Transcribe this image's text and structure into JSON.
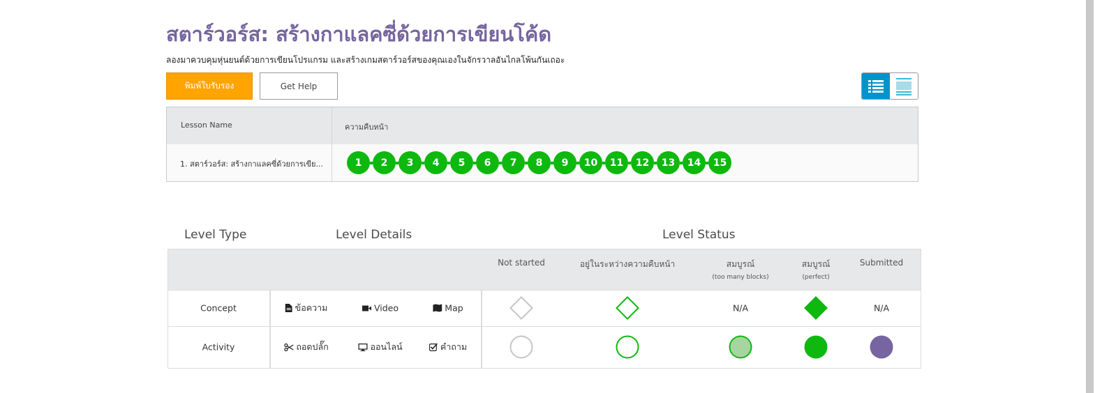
{
  "page": {
    "title": "สตาร์วอร์ส: สร้างกาแลคซี่ด้วยการเขียนโค้ด",
    "subtitle": "ลองมาควบคุมหุ่นยนต์ด้วยการเขียนโปรแกรม และสร้างเกมสตาร์วอร์สของคุณเองในจักรวาลอันไกลโพ้นกันเถอะ"
  },
  "buttons": {
    "certificate": "พิมพ์ใบรับรอง",
    "help": "Get Help"
  },
  "view_toggle": {
    "selected": "list"
  },
  "progress_table": {
    "headers": {
      "lesson_name": "Lesson Name",
      "progress": "ความคืบหน้า"
    },
    "rows": [
      {
        "lesson": "1. สตาร์วอร์ส: สร้างกาแลคซี่ด้วยการเขีย...",
        "levels": [
          "1",
          "2",
          "3",
          "4",
          "5",
          "6",
          "7",
          "8",
          "9",
          "10",
          "11",
          "12",
          "13",
          "14",
          "15"
        ]
      }
    ]
  },
  "key": {
    "headings": {
      "level_type": "Level Type",
      "level_details": "Level Details",
      "level_status": "Level Status"
    },
    "status_columns": [
      {
        "label": "Not started",
        "sub": ""
      },
      {
        "label": "อยู่ในระหว่างความคืบหน้า",
        "sub": ""
      },
      {
        "label": "สมบูรณ์",
        "sub": "(too many blocks)"
      },
      {
        "label": "สมบูรณ์",
        "sub": "(perfect)"
      },
      {
        "label": "Submitted",
        "sub": ""
      }
    ],
    "rows": [
      {
        "type": "Concept",
        "details": [
          {
            "icon": "document-icon",
            "label": "ข้อความ"
          },
          {
            "icon": "video-camera-icon",
            "label": "Video"
          },
          {
            "icon": "map-icon",
            "label": "Map"
          }
        ],
        "statuses": [
          "diamond-empty-grey",
          "diamond-empty-green",
          "N/A",
          "diamond-filled-green",
          "N/A"
        ]
      },
      {
        "type": "Activity",
        "details": [
          {
            "icon": "scissors-icon",
            "label": "ถอดปลั๊ก"
          },
          {
            "icon": "desktop-icon",
            "label": "ออนไลน์"
          },
          {
            "icon": "checkbox-icon",
            "label": "คำถาม"
          }
        ],
        "statuses": [
          "circle-empty-grey",
          "circle-empty-green",
          "circle-light-green",
          "circle-filled-green",
          "circle-purple"
        ]
      }
    ]
  },
  "colors": {
    "title": "#7665a0",
    "certificate_button": "#ffa400",
    "toggle_active": "#0094ca",
    "complete_green": "#0eb80f",
    "too_many_blocks_fill": "#a5d6a0",
    "submitted_purple": "#7665a0",
    "not_started_grey": "#c6c6c6"
  }
}
